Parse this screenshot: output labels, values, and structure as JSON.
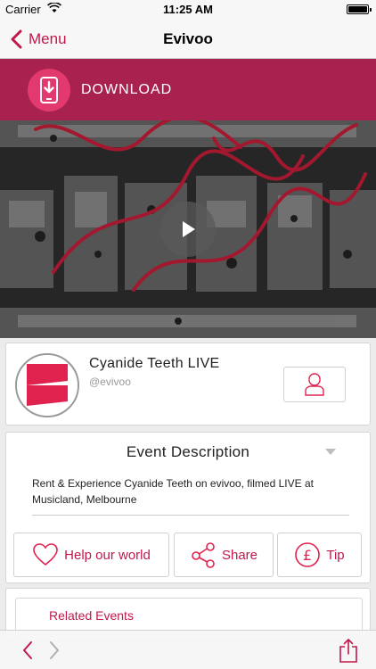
{
  "status_bar": {
    "carrier": "Carrier",
    "time": "11:25 AM"
  },
  "nav": {
    "back_label": "Menu",
    "title": "Evivoo"
  },
  "banner": {
    "label": "DOWNLOAD"
  },
  "profile": {
    "name": "Cyanide Teeth LIVE",
    "handle": "@evivoo"
  },
  "event": {
    "title": "Event Description",
    "description": "Rent & Experience Cyanide Teeth on evivoo, filmed LIVE at Musicland, Melbourne"
  },
  "actions": {
    "help_label": "Help our world",
    "share_label": "Share",
    "tip_label": "Tip"
  },
  "related": {
    "label": "Related Events"
  },
  "colors": {
    "accent": "#c1184a",
    "banner": "#a8214f",
    "banner_icon": "#e23a6e"
  },
  "icons": [
    "wifi-icon",
    "battery-icon",
    "chevron-left-icon",
    "phone-download-icon",
    "play-icon",
    "user-icon",
    "chevron-down-icon",
    "heart-icon",
    "share-icon",
    "pound-icon",
    "chevron-right-icon",
    "upload-icon"
  ]
}
